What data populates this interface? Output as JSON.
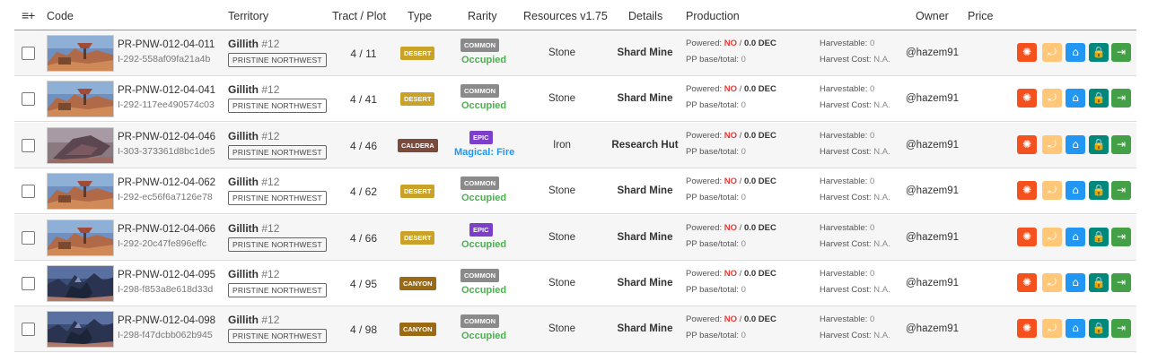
{
  "header": {
    "sort_icon": "≡+",
    "code": "Code",
    "territory": "Territory",
    "tract_plot": "Tract / Plot",
    "type": "Type",
    "rarity": "Rarity",
    "resources": "Resources v1.75",
    "details": "Details",
    "production": "Production",
    "owner": "Owner",
    "price": "Price"
  },
  "labels": {
    "powered": "Powered:",
    "no": "NO",
    "pp": "PP base/total:",
    "harvestable": "Harvestable:",
    "harvest_cost": "Harvest Cost:",
    "na": "N.A."
  },
  "colors": {
    "desert": "#c9a227",
    "caldera": "#7a4a3a",
    "canyon": "#9a6a14",
    "common": "#8a8a8a",
    "epic": "#7b3fc9",
    "occupied": "#4caf50",
    "magical": "#2196f3",
    "btn_settings": "#f4511e",
    "btn_harvest": "#ffc777",
    "btn_shop": "#2196f3",
    "btn_lock": "#00897b",
    "btn_exit": "#43a047"
  },
  "rows": [
    {
      "code": "PR-PNW-012-04-011",
      "id": "I-292-558af09fa21a4b",
      "territory": "Gillith",
      "territory_num": "#12",
      "region": "PRISTINE NORTHWEST",
      "tract": "4 / 11",
      "type": "DESERT",
      "rarity": "COMMON",
      "status": "Occupied",
      "resource": "Stone",
      "details": "Shard Mine",
      "power": "0.0 DEC",
      "pp": "0",
      "harvestable": "0",
      "owner": "@hazem91",
      "image": "desert"
    },
    {
      "code": "PR-PNW-012-04-041",
      "id": "I-292-117ee490574c03",
      "territory": "Gillith",
      "territory_num": "#12",
      "region": "PRISTINE NORTHWEST",
      "tract": "4 / 41",
      "type": "DESERT",
      "rarity": "COMMON",
      "status": "Occupied",
      "resource": "Stone",
      "details": "Shard Mine",
      "power": "0.0 DEC",
      "pp": "0",
      "harvestable": "0",
      "owner": "@hazem91",
      "image": "desert"
    },
    {
      "code": "PR-PNW-012-04-046",
      "id": "I-303-373361d8bc1de5",
      "territory": "Gillith",
      "territory_num": "#12",
      "region": "PRISTINE NORTHWEST",
      "tract": "4 / 46",
      "type": "CALDERA",
      "rarity": "EPIC",
      "status": "Magical: Fire",
      "resource": "Iron",
      "details": "Research Hut",
      "power": "0.0 DEC",
      "pp": "0",
      "harvestable": "0",
      "owner": "@hazem91",
      "image": "caldera"
    },
    {
      "code": "PR-PNW-012-04-062",
      "id": "I-292-ec56f6a7126e78",
      "territory": "Gillith",
      "territory_num": "#12",
      "region": "PRISTINE NORTHWEST",
      "tract": "4 / 62",
      "type": "DESERT",
      "rarity": "COMMON",
      "status": "Occupied",
      "resource": "Stone",
      "details": "Shard Mine",
      "power": "0.0 DEC",
      "pp": "0",
      "harvestable": "0",
      "owner": "@hazem91",
      "image": "desert"
    },
    {
      "code": "PR-PNW-012-04-066",
      "id": "I-292-20c47fe896effc",
      "territory": "Gillith",
      "territory_num": "#12",
      "region": "PRISTINE NORTHWEST",
      "tract": "4 / 66",
      "type": "DESERT",
      "rarity": "EPIC",
      "status": "Occupied",
      "resource": "Stone",
      "details": "Shard Mine",
      "power": "0.0 DEC",
      "pp": "0",
      "harvestable": "0",
      "owner": "@hazem91",
      "image": "desert"
    },
    {
      "code": "PR-PNW-012-04-095",
      "id": "I-298-f853a8e618d33d",
      "territory": "Gillith",
      "territory_num": "#12",
      "region": "PRISTINE NORTHWEST",
      "tract": "4 / 95",
      "type": "CANYON",
      "rarity": "COMMON",
      "status": "Occupied",
      "resource": "Stone",
      "details": "Shard Mine",
      "power": "0.0 DEC",
      "pp": "0",
      "harvestable": "0",
      "owner": "@hazem91",
      "image": "canyon"
    },
    {
      "code": "PR-PNW-012-04-098",
      "id": "I-298-f47dcbb062b945",
      "territory": "Gillith",
      "territory_num": "#12",
      "region": "PRISTINE NORTHWEST",
      "tract": "4 / 98",
      "type": "CANYON",
      "rarity": "COMMON",
      "status": "Occupied",
      "resource": "Stone",
      "details": "Shard Mine",
      "power": "0.0 DEC",
      "pp": "0",
      "harvestable": "0",
      "owner": "@hazem91",
      "image": "canyon"
    }
  ],
  "action_icons": [
    "gear-icon",
    "harvest-icon",
    "shop-icon",
    "lock-icon",
    "exit-icon"
  ]
}
